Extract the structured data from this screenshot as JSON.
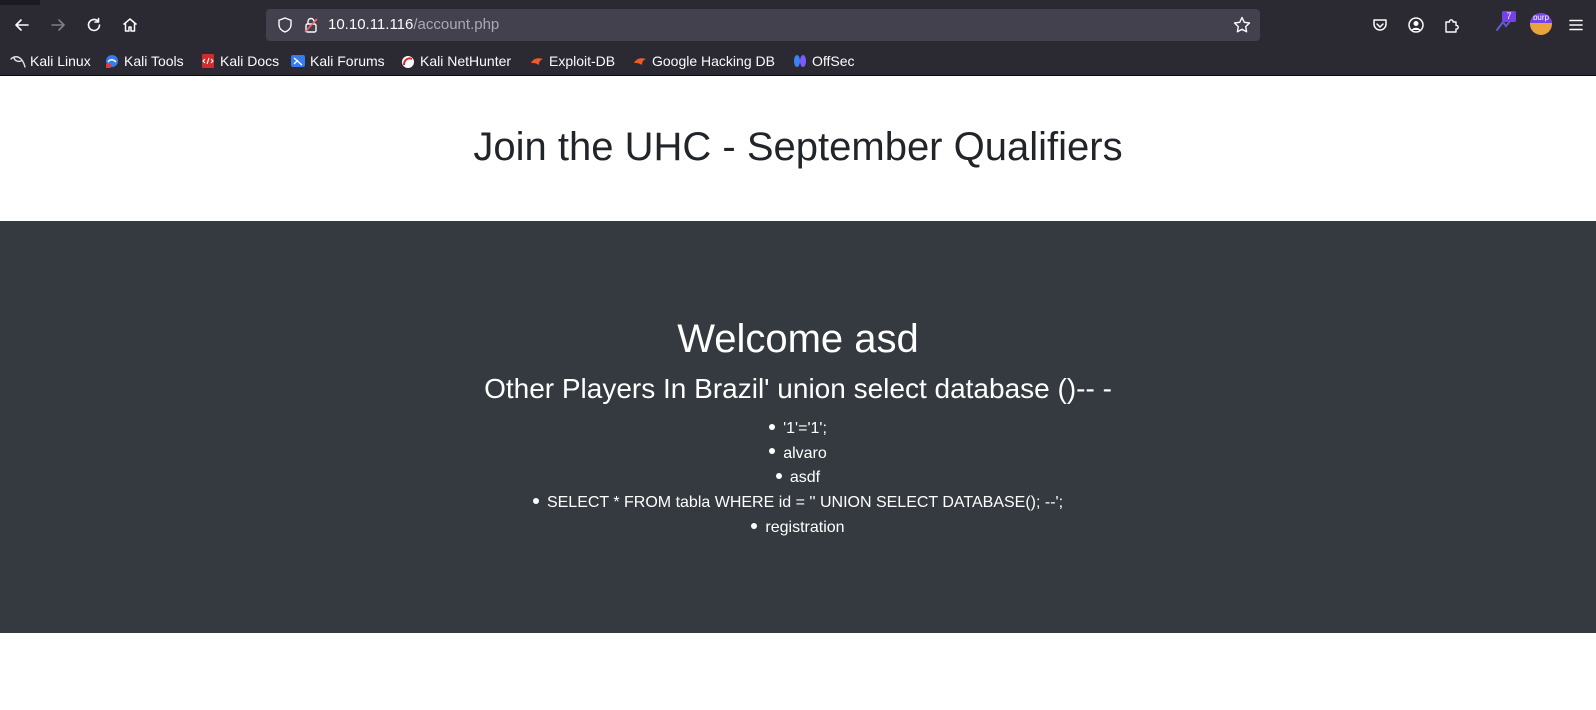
{
  "browser": {
    "url_host": "10.10.11.116",
    "url_path": "/account.php",
    "extension_badge": "7",
    "burp_label": "burp"
  },
  "bookmarks": [
    {
      "label": "Kali Linux",
      "icon": "kali-dragon-icon"
    },
    {
      "label": "Kali Tools",
      "icon": "kali-tools-icon"
    },
    {
      "label": "Kali Docs",
      "icon": "kali-docs-icon"
    },
    {
      "label": "Kali Forums",
      "icon": "kali-forums-icon"
    },
    {
      "label": "Kali NetHunter",
      "icon": "nethunter-icon"
    },
    {
      "label": "Exploit-DB",
      "icon": "exploit-db-icon"
    },
    {
      "label": "Google Hacking DB",
      "icon": "ghdb-icon"
    },
    {
      "label": "OffSec",
      "icon": "offsec-icon"
    }
  ],
  "page": {
    "title": "Join the UHC - September Qualifiers",
    "welcome": "Welcome asd",
    "other_players_heading": "Other Players In Brazil' union select database ()-- -",
    "players": [
      "'1'='1';",
      "alvaro",
      "asdf",
      "SELECT * FROM tabla WHERE id = '' UNION SELECT DATABASE(); --';",
      "registration"
    ]
  },
  "colors": {
    "chrome_bg": "#2b2a33",
    "urlbar_bg": "#42414d",
    "dark_section": "#343a40",
    "heading_text": "#212529"
  }
}
